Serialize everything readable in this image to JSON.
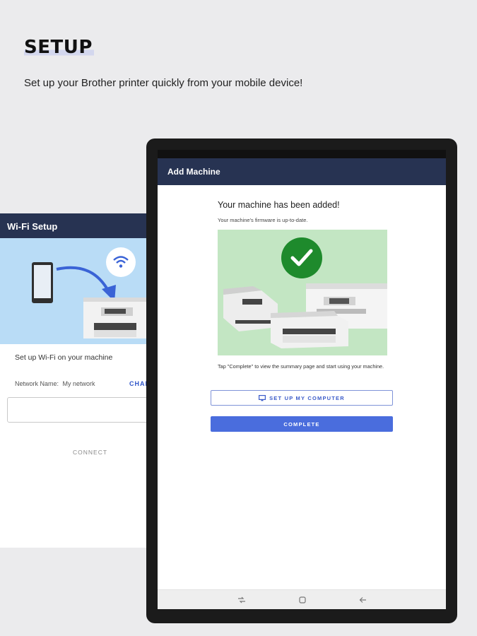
{
  "hero": {
    "title": "SETUP",
    "subtitle": "Set up your Brother printer quickly from your mobile device!"
  },
  "wifi_setup": {
    "title": "Wi-Fi Setup",
    "section_title": "Set up Wi-Fi on your machine",
    "network_label": "Network Name:",
    "network_value": "My network",
    "change_label": "CHAN",
    "password_value": "",
    "connect_label": "CONNECT"
  },
  "add_machine": {
    "title": "Add Machine",
    "headline": "Your machine has been added!",
    "firmware_status": "Your machine's firmware is up-to-date.",
    "hint": "Tap \"Complete\" to view the summary page and start using your machine.",
    "setup_computer_label": "SET UP MY COMPUTER",
    "complete_label": "COMPLETE"
  },
  "icons": {
    "success": "check-icon",
    "wifi": "wifi-icon",
    "computer": "monitor-icon",
    "nav": [
      "recent-apps-icon",
      "home-icon",
      "back-icon"
    ]
  },
  "colors": {
    "app_bar": "#273352",
    "accent": "#4a6ddd",
    "success": "#1e8a2c",
    "illustration_green": "#c3e6c3",
    "illustration_blue": "#b9dcf6"
  }
}
